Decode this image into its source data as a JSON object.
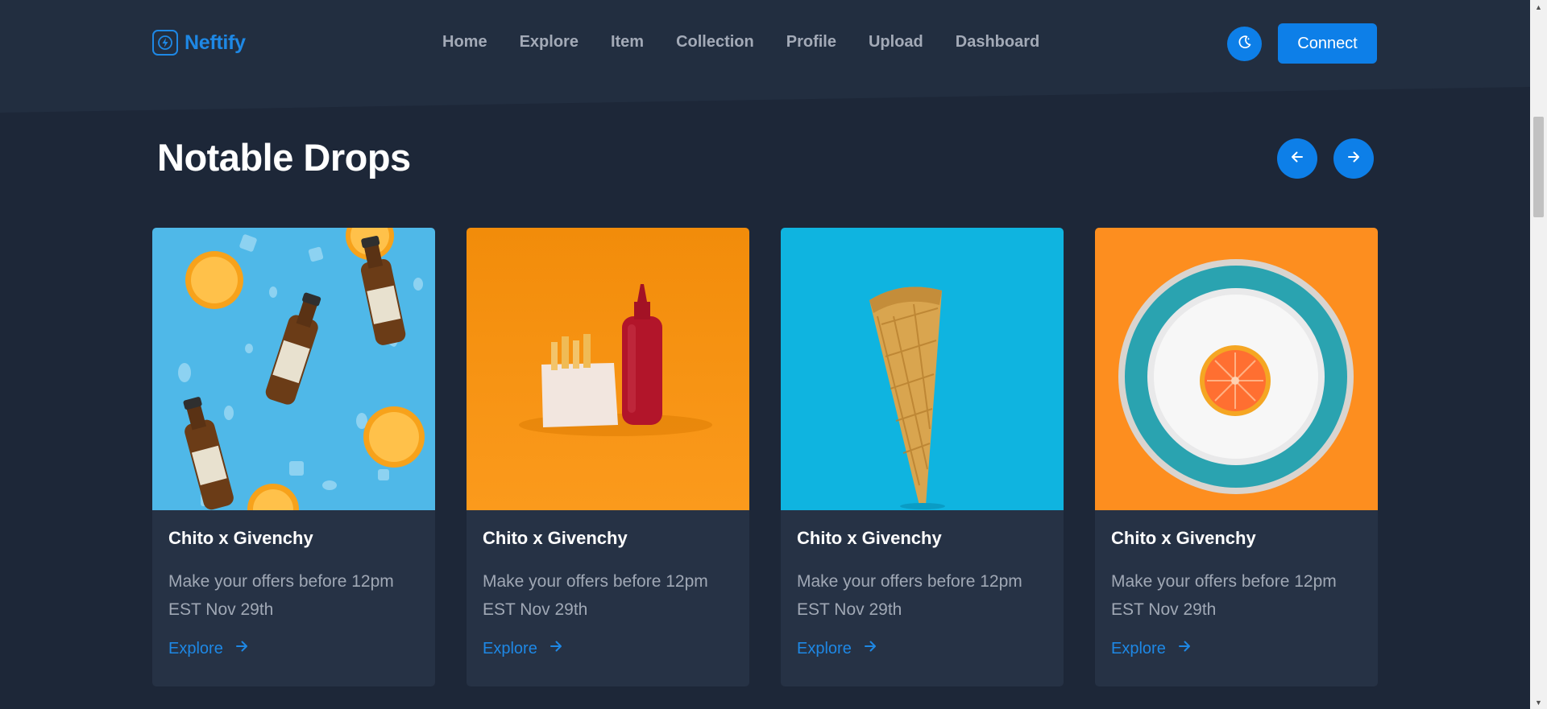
{
  "brand": {
    "name": "Neftify",
    "accent": "#1e88e5"
  },
  "nav": {
    "items": [
      {
        "label": "Home"
      },
      {
        "label": "Explore"
      },
      {
        "label": "Item"
      },
      {
        "label": "Collection"
      },
      {
        "label": "Profile"
      },
      {
        "label": "Upload"
      },
      {
        "label": "Dashboard"
      }
    ]
  },
  "header": {
    "theme_toggle_icon": "moon-icon",
    "connect_label": "Connect"
  },
  "section": {
    "title": "Notable Drops",
    "prev_icon": "arrow-left-icon",
    "next_icon": "arrow-right-icon"
  },
  "cards": [
    {
      "image": "ginger-beer-oranges",
      "title": "Chito x Givenchy",
      "description": "Make your offers before 12pm EST Nov 29th",
      "link_label": "Explore"
    },
    {
      "image": "fries-ketchup",
      "title": "Chito x Givenchy",
      "description": "Make your offers before 12pm EST Nov 29th",
      "link_label": "Explore"
    },
    {
      "image": "waffle-cone",
      "title": "Chito x Givenchy",
      "description": "Make your offers before 12pm EST Nov 29th",
      "link_label": "Explore"
    },
    {
      "image": "orange-plate",
      "title": "Chito x Givenchy",
      "description": "Make your offers before 12pm EST Nov 29th",
      "link_label": "Explore"
    }
  ],
  "colors": {
    "background": "#1d2738",
    "header_background": "#222e40",
    "card_background": "#263245",
    "primary_button": "#0d7fe8",
    "muted_text": "#a3aab7"
  }
}
